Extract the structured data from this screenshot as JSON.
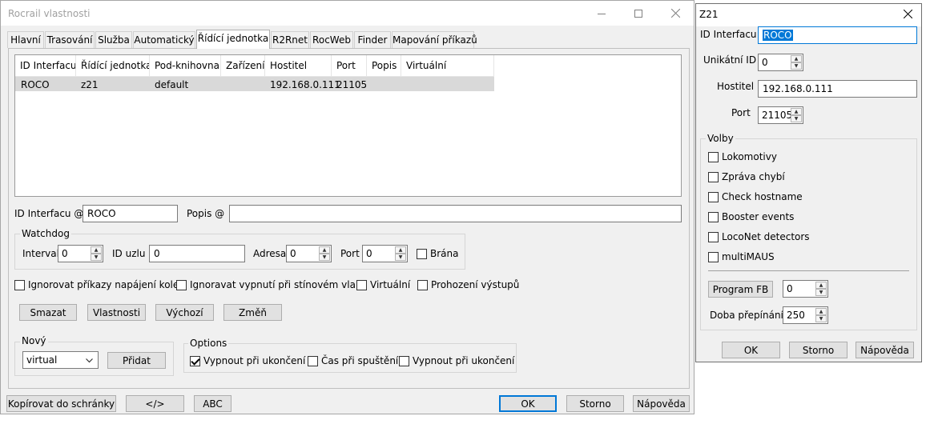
{
  "main": {
    "title": "Rocrail vlastnosti",
    "tabs": [
      "Hlavní",
      "Trasování",
      "Služba",
      "Automatický",
      "Řídící jednotka",
      "R2Rnet",
      "RocWeb",
      "Finder",
      "Mapování příkazů"
    ],
    "active_tab_index": 4,
    "table": {
      "headers": [
        "ID Interfacu",
        "Řídící jednotka",
        "Pod-knihovna",
        "Zařízení",
        "Hostitel",
        "Port",
        "Popis",
        "Virtuální"
      ],
      "rows": [
        [
          "ROCO",
          "z21",
          "default",
          "",
          "192.168.0.111",
          "21105",
          "",
          ""
        ]
      ]
    },
    "id_label": "ID Interfacu @",
    "id_value": "ROCO",
    "popis_label": "Popis @",
    "popis_value": "",
    "watchdog": {
      "title": "Watchdog",
      "interval_label": "Interval",
      "interval_value": "0",
      "node_label": "ID uzlu",
      "node_value": "0",
      "address_label": "Adresa",
      "address_value": "0",
      "port_label": "Port",
      "port_value": "0",
      "gate_label": "Brána",
      "gate_checked": false
    },
    "options_row": [
      {
        "label": "Ignorovat příkazy napájení koleji",
        "checked": false
      },
      {
        "label": "Ignoravat vypnutí při stínovém vlaku",
        "checked": false
      },
      {
        "label": "Virtuální",
        "checked": false
      },
      {
        "label": "Prohození výstupů",
        "checked": false
      }
    ],
    "buttons": {
      "delete": "Smazat",
      "properties": "Vlastnosti",
      "default": "Výchozí",
      "change": "Změň"
    },
    "new_group": {
      "title": "Nový",
      "select_value": "virtual",
      "add": "Přidat"
    },
    "options_group": {
      "title": "Options",
      "items": [
        {
          "label": "Vypnout při ukončení",
          "checked": true
        },
        {
          "label": "Čas při spuštění",
          "checked": false
        },
        {
          "label": "Vypnout při ukončení",
          "checked": false
        }
      ]
    },
    "bottom": {
      "copy": "Kopírovat do schránky",
      "xml": "</>",
      "abc": "ABC",
      "ok": "OK",
      "cancel": "Storno",
      "help": "Nápověda"
    }
  },
  "z21": {
    "title": "Z21",
    "id_label": "ID Interfacu",
    "id_value": "ROCO",
    "unique_label": "Unikátní ID",
    "unique_value": "0",
    "host_label": "Hostitel",
    "host_value": "192.168.0.111",
    "port_label": "Port",
    "port_value": "21105",
    "options_title": "Volby",
    "options": [
      {
        "label": "Lokomotivy",
        "checked": false
      },
      {
        "label": "Zpráva chybí",
        "checked": false
      },
      {
        "label": "Check hostname",
        "checked": false
      },
      {
        "label": "Booster events",
        "checked": false
      },
      {
        "label": "LocoNet detectors",
        "checked": false
      },
      {
        "label": "multiMAUS",
        "checked": false
      }
    ],
    "program_fb_label": "Program FB",
    "program_fb_value": "0",
    "switch_time_label": "Doba přepínání",
    "switch_time_value": "250",
    "ok": "OK",
    "cancel": "Storno",
    "help": "Nápověda"
  },
  "colors": {
    "accent": "#0078d7",
    "selection": "#0078d7",
    "window_bg": "#f0f0f0",
    "row_highlight": "#d9d9d9"
  }
}
